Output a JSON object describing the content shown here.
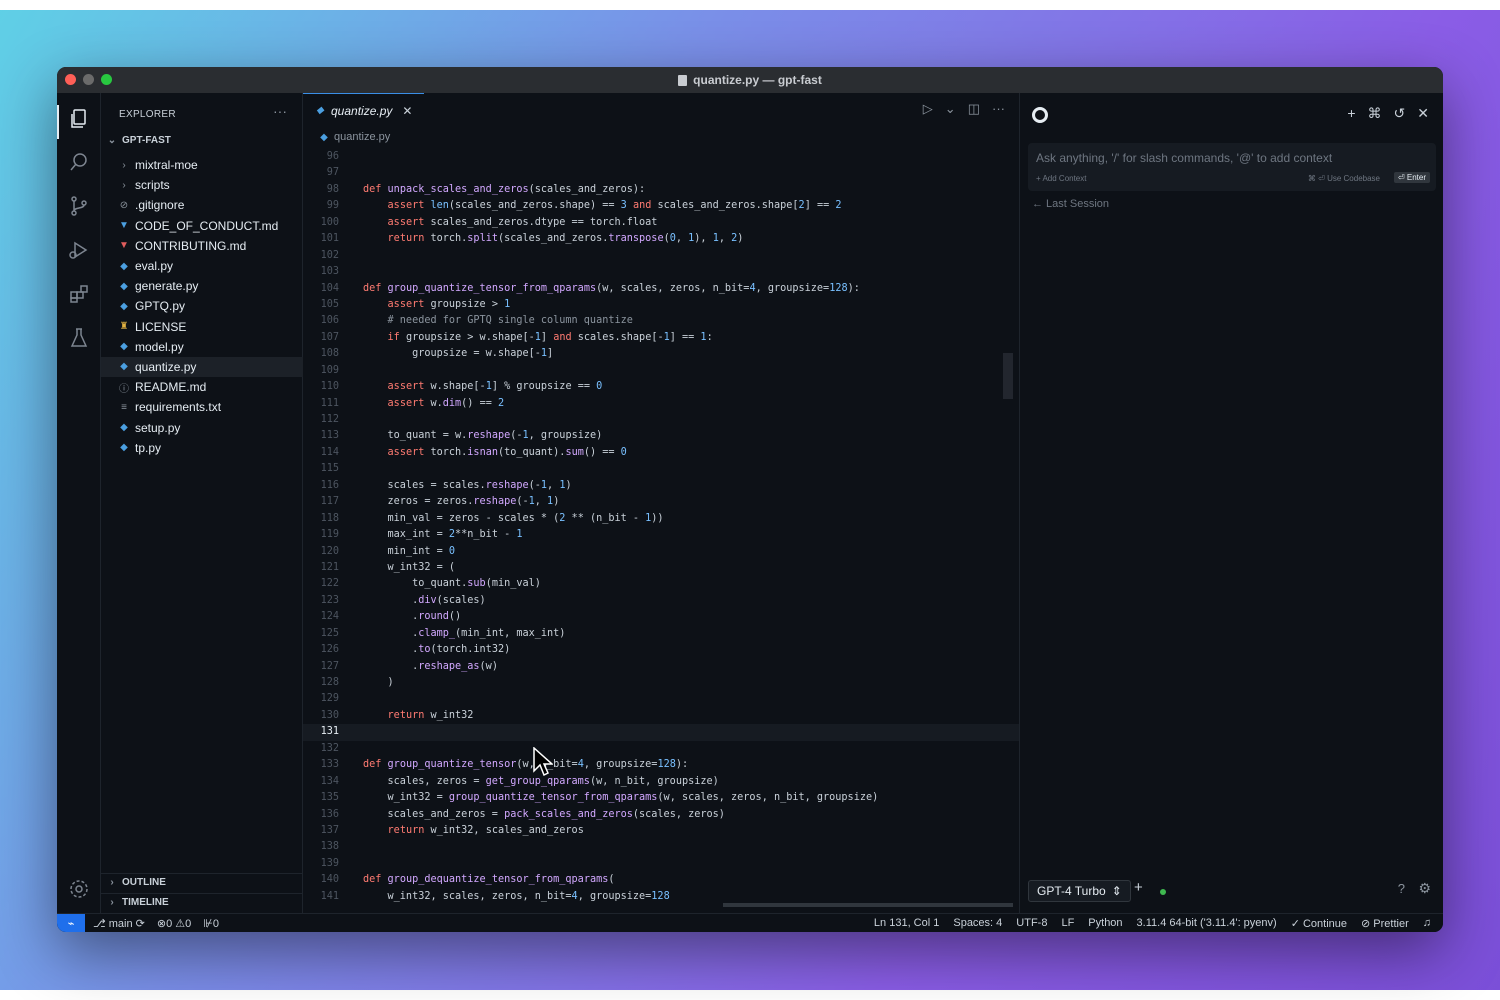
{
  "window": {
    "title": "quantize.py — gpt-fast"
  },
  "sidebar": {
    "header": "EXPLORER",
    "more": "···",
    "folder": "GPT-FAST",
    "items": [
      {
        "label": "mixtral-moe",
        "type": "folder"
      },
      {
        "label": "scripts",
        "type": "folder"
      },
      {
        "label": ".gitignore",
        "type": "file"
      },
      {
        "label": "CODE_OF_CONDUCT.md",
        "type": "md"
      },
      {
        "label": "CONTRIBUTING.md",
        "type": "md-red"
      },
      {
        "label": "eval.py",
        "type": "py"
      },
      {
        "label": "generate.py",
        "type": "py"
      },
      {
        "label": "GPTQ.py",
        "type": "py"
      },
      {
        "label": "LICENSE",
        "type": "license"
      },
      {
        "label": "model.py",
        "type": "py"
      },
      {
        "label": "quantize.py",
        "type": "py",
        "selected": true
      },
      {
        "label": "README.md",
        "type": "info"
      },
      {
        "label": "requirements.txt",
        "type": "txt"
      },
      {
        "label": "setup.py",
        "type": "py"
      },
      {
        "label": "tp.py",
        "type": "py"
      }
    ],
    "outline": "OUTLINE",
    "timeline": "TIMELINE"
  },
  "editor": {
    "tab_label": "quantize.py",
    "tab_close": "✕",
    "breadcrumb": "quantize.py",
    "current_line": 131,
    "lines": [
      {
        "n": "96",
        "code": ""
      },
      {
        "n": "97",
        "code": ""
      },
      {
        "n": "98",
        "code": "def unpack_scales_and_zeros(scales_and_zeros):"
      },
      {
        "n": "99",
        "code": "    assert len(scales_and_zeros.shape) == 3 and scales_and_zeros.shape[2] == 2"
      },
      {
        "n": "100",
        "code": "    assert scales_and_zeros.dtype == torch.float"
      },
      {
        "n": "101",
        "code": "    return torch.split(scales_and_zeros.transpose(0, 1), 1, 2)"
      },
      {
        "n": "102",
        "code": ""
      },
      {
        "n": "103",
        "code": ""
      },
      {
        "n": "104",
        "code": "def group_quantize_tensor_from_qparams(w, scales, zeros, n_bit=4, groupsize=128):"
      },
      {
        "n": "105",
        "code": "    assert groupsize > 1"
      },
      {
        "n": "106",
        "code": "    # needed for GPTQ single column quantize"
      },
      {
        "n": "107",
        "code": "    if groupsize > w.shape[-1] and scales.shape[-1] == 1:"
      },
      {
        "n": "108",
        "code": "        groupsize = w.shape[-1]"
      },
      {
        "n": "109",
        "code": ""
      },
      {
        "n": "110",
        "code": "    assert w.shape[-1] % groupsize == 0"
      },
      {
        "n": "111",
        "code": "    assert w.dim() == 2"
      },
      {
        "n": "112",
        "code": ""
      },
      {
        "n": "113",
        "code": "    to_quant = w.reshape(-1, groupsize)"
      },
      {
        "n": "114",
        "code": "    assert torch.isnan(to_quant).sum() == 0"
      },
      {
        "n": "115",
        "code": ""
      },
      {
        "n": "116",
        "code": "    scales = scales.reshape(-1, 1)"
      },
      {
        "n": "117",
        "code": "    zeros = zeros.reshape(-1, 1)"
      },
      {
        "n": "118",
        "code": "    min_val = zeros - scales * (2 ** (n_bit - 1))"
      },
      {
        "n": "119",
        "code": "    max_int = 2**n_bit - 1"
      },
      {
        "n": "120",
        "code": "    min_int = 0"
      },
      {
        "n": "121",
        "code": "    w_int32 = ("
      },
      {
        "n": "122",
        "code": "        to_quant.sub(min_val)"
      },
      {
        "n": "123",
        "code": "        .div(scales)"
      },
      {
        "n": "124",
        "code": "        .round()"
      },
      {
        "n": "125",
        "code": "        .clamp_(min_int, max_int)"
      },
      {
        "n": "126",
        "code": "        .to(torch.int32)"
      },
      {
        "n": "127",
        "code": "        .reshape_as(w)"
      },
      {
        "n": "128",
        "code": "    )"
      },
      {
        "n": "129",
        "code": ""
      },
      {
        "n": "130",
        "code": "    return w_int32"
      },
      {
        "n": "131",
        "code": ""
      },
      {
        "n": "132",
        "code": ""
      },
      {
        "n": "133",
        "code": "def group_quantize_tensor(w, n_bit=4, groupsize=128):"
      },
      {
        "n": "134",
        "code": "    scales, zeros = get_group_qparams(w, n_bit, groupsize)"
      },
      {
        "n": "135",
        "code": "    w_int32 = group_quantize_tensor_from_qparams(w, scales, zeros, n_bit, groupsize)"
      },
      {
        "n": "136",
        "code": "    scales_and_zeros = pack_scales_and_zeros(scales, zeros)"
      },
      {
        "n": "137",
        "code": "    return w_int32, scales_and_zeros"
      },
      {
        "n": "138",
        "code": ""
      },
      {
        "n": "139",
        "code": ""
      },
      {
        "n": "140",
        "code": "def group_dequantize_tensor_from_qparams("
      },
      {
        "n": "141",
        "code": "    w_int32, scales, zeros, n_bit=4, groupsize=128"
      }
    ]
  },
  "chat": {
    "placeholder": "Ask anything, '/' for slash commands, '@' to add context",
    "add_context": "+ Add Context",
    "use_codebase": "⌘ ⏎ Use Codebase",
    "enter": "⏎ Enter",
    "last_session": "← Last Session",
    "model": "GPT-4 Turbo"
  },
  "status": {
    "branch": "main",
    "errors": "0",
    "warnings": "0",
    "ports": "0",
    "position": "Ln 131, Col 1",
    "spaces": "Spaces: 4",
    "encoding": "UTF-8",
    "eol": "LF",
    "language": "Python",
    "interpreter": "3.11.4 64-bit ('3.11.4': pyenv)",
    "continue": "✓ Continue",
    "prettier": "⊘ Prettier"
  },
  "colors": {
    "accent": "#1f6feb",
    "background": "#0d1117",
    "keyword": "#ff7b72",
    "function": "#d2a8ff",
    "number": "#79c0ff"
  }
}
